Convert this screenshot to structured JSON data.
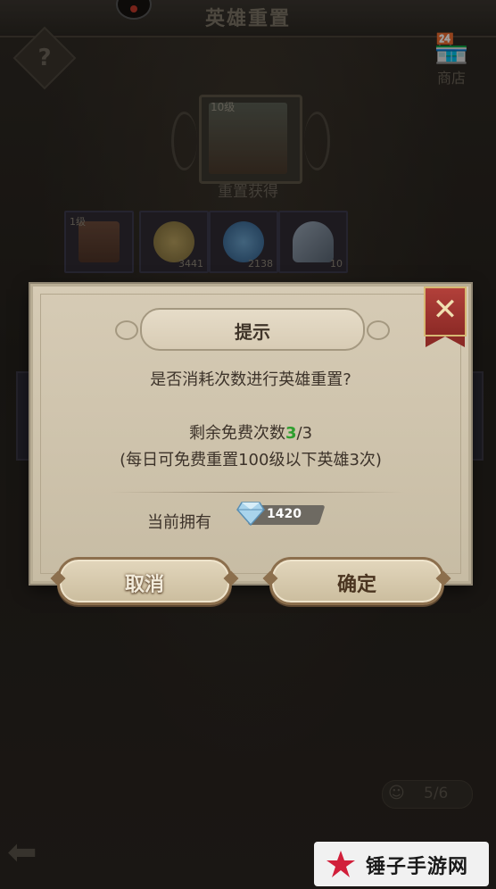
{
  "screen": {
    "title": "英雄重置",
    "help_icon": "question-mark-icon",
    "shop_label": "商店",
    "hero": {
      "level": "10级"
    },
    "reset_gain_label": "重置获得",
    "rewards": [
      {
        "kind": "hero",
        "level": "1级"
      },
      {
        "kind": "gold-coin",
        "amount": "3441"
      },
      {
        "kind": "blue-essence",
        "amount": "2138"
      },
      {
        "kind": "crystal-pile",
        "amount": "10"
      }
    ],
    "hero_count": "5/6"
  },
  "dialog": {
    "title": "提示",
    "question": "是否消耗次数进行英雄重置?",
    "free_label": "剩余免费次数",
    "free_used": "3",
    "free_total": "/3",
    "note": "(每日可免费重置100级以下英雄3次)",
    "owned_label": "当前拥有",
    "gems": "1420",
    "cancel_label": "取消",
    "confirm_label": "确定"
  },
  "watermark": {
    "text": "锤子手游网"
  },
  "colors": {
    "dialog_bg": "#d6cbb5",
    "close_red": "#a3362f",
    "highlight_green": "#2e9e2e",
    "cancel_text": "#f3ecdc",
    "confirm_text": "#4a3420"
  }
}
